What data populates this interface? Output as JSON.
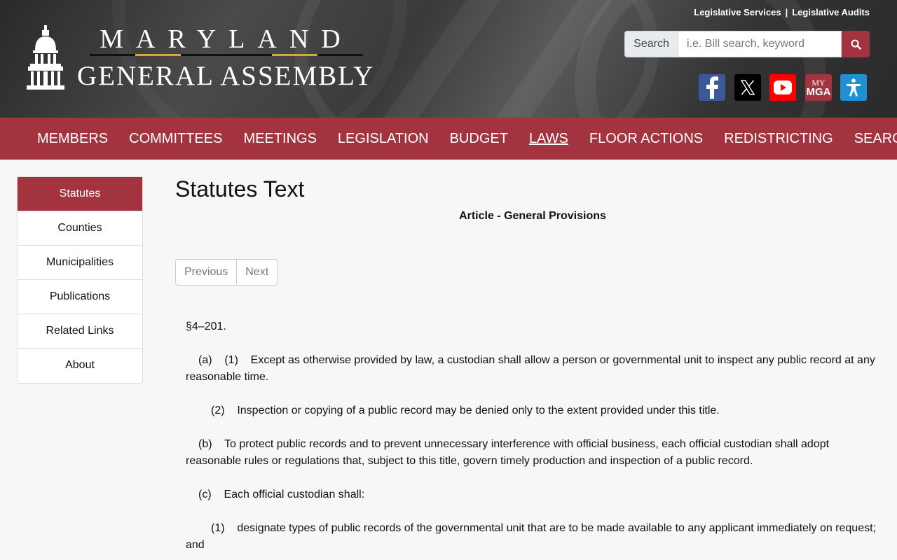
{
  "header": {
    "brand_top": "MARYLAND",
    "brand_bottom": "GENERAL ASSEMBLY",
    "top_links": [
      "Legislative Services",
      "Legislative Audits"
    ],
    "top_links_separator": "|",
    "search_label": "Search",
    "search_placeholder": "i.e. Bill search, keyword",
    "mga_line1": "MY",
    "mga_line2": "MGA"
  },
  "nav": [
    "MEMBERS",
    "COMMITTEES",
    "MEETINGS",
    "LEGISLATION",
    "BUDGET",
    "LAWS",
    "FLOOR ACTIONS",
    "REDISTRICTING",
    "SEARCH"
  ],
  "sidebar": [
    "Statutes",
    "Counties",
    "Municipalities",
    "Publications",
    "Related Links",
    "About"
  ],
  "main": {
    "title": "Statutes Text",
    "article": "Article - General Provisions",
    "previous": "Previous",
    "next": "Next",
    "section": "§4–201.",
    "paragraphs": [
      "(a)    (1)    Except as otherwise provided by law, a custodian shall allow a person or governmental unit to inspect any public record at any reasonable time.",
      "(2)    Inspection or copying of a public record may be denied only to the extent provided under this title.",
      "(b)    To protect public records and to prevent unnecessary interference with official business, each official custodian shall adopt reasonable rules or regulations that, subject to this title, govern timely production and inspection of a public record.",
      "(c)    Each official custodian shall:",
      "(1)    designate types of public records of the governmental unit that are to be made available to any applicant immediately on request; and"
    ]
  },
  "colors": {
    "brand_red": "#a3343f",
    "gold": "#d4a93a"
  },
  "icons": [
    "capitol-dome-icon",
    "search-icon",
    "facebook-icon",
    "x-twitter-icon",
    "youtube-icon",
    "my-mga-icon",
    "accessibility-icon"
  ]
}
